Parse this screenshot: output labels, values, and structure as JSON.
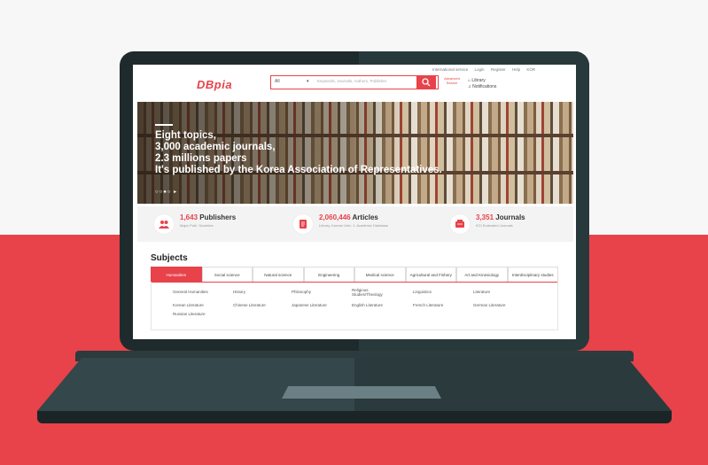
{
  "top_links": [
    "International service",
    "Login",
    "Register",
    "Help",
    "KOR"
  ],
  "logo": "DBpia",
  "search": {
    "scope": "All",
    "caret": "▾",
    "placeholder": "Keywords, Journals, Authors, Publisher"
  },
  "advanced_search": "Advanced Search",
  "library": {
    "library_label": "Library",
    "notifications_label": "Notifications"
  },
  "hero": {
    "lines": [
      "Eight topics,",
      "3,000 academic journals,",
      "2.3 millions papers",
      "It's published by the Korea Association of Representatives."
    ],
    "pager": "○○●○ ▸"
  },
  "stats": [
    {
      "number": "1,643",
      "label": "Publishers",
      "sub": "Major Publ. Societies",
      "icon": "people-icon"
    },
    {
      "number": "2,060,446",
      "label": "Articles",
      "sub": "Library, Korean Univ. 1. Academic Database",
      "icon": "document-icon"
    },
    {
      "number": "3,351",
      "label": "Journals",
      "sub": "KCI Evaluated Journals",
      "icon": "journal-icon"
    }
  ],
  "subjects": {
    "title": "Subjects",
    "tabs": [
      {
        "label": "Humanities",
        "active": true
      },
      {
        "label": "Social science"
      },
      {
        "label": "Natural science"
      },
      {
        "label": "Engineering"
      },
      {
        "label": "Medical science"
      },
      {
        "label": "Agricultural and Fishery"
      },
      {
        "label": "Art and Kinesiology"
      },
      {
        "label": "Interdisciplinary studies"
      }
    ],
    "items": [
      "General Humanities",
      "History",
      "Philosophy",
      "Religious Studies/Theology",
      "Linguistics",
      "Literature",
      "Korean Literature",
      "Chinese Literature",
      "Japanese Literature",
      "English Literature",
      "French Literature",
      "German Literature",
      "Russian Literature"
    ]
  },
  "colors": {
    "brand": "#e8424a",
    "laptop": "#1f2a2c",
    "background_band": "#e8424a"
  }
}
